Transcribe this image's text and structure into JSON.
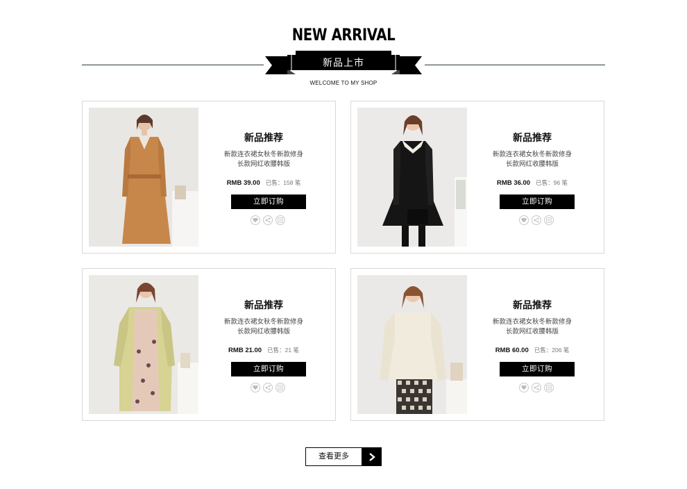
{
  "header": {
    "title": "NEW ARRIVAL",
    "ribbon_label": "新品上市",
    "subtitle": "WELCOME TO MY SHOP"
  },
  "products": [
    {
      "name": "新品推荐",
      "desc_line1": "新款连衣裙女秋冬新款修身",
      "desc_line2": "长款网红收腰韩版",
      "price": "RMB 39.00",
      "sold": "已售：158 笔",
      "buy_label": "立即订购",
      "image": "camel trench coat"
    },
    {
      "name": "新品推荐",
      "desc_line1": "新款连衣裙女秋冬新款修身",
      "desc_line2": "长款网红收腰韩版",
      "price": "RMB 36.00",
      "sold": "已售：96 笔",
      "buy_label": "立即订购",
      "image": "black dress with lace collar"
    },
    {
      "name": "新品推荐",
      "desc_line1": "新款连衣裙女秋冬新款修身",
      "desc_line2": "长款网红收腰韩版",
      "price": "RMB 21.00",
      "sold": "已售：21 笔",
      "buy_label": "立即订购",
      "image": "pale yellow coat over floral dress"
    },
    {
      "name": "新品推荐",
      "desc_line1": "新款连衣裙女秋冬新款修身",
      "desc_line2": "长款网红收腰韩版",
      "price": "RMB 60.00",
      "sold": "已售：206 笔",
      "buy_label": "立即订购",
      "image": "cream sweater with houndstooth skirt"
    }
  ],
  "icons": [
    "heart-icon",
    "share-icon",
    "comment-icon"
  ],
  "more": {
    "label": "查看更多",
    "icon": "chevron-right-icon"
  },
  "colors": {
    "accent": "#000000",
    "card_border": "#d8d8d8",
    "rule": "#2b3a3a"
  }
}
